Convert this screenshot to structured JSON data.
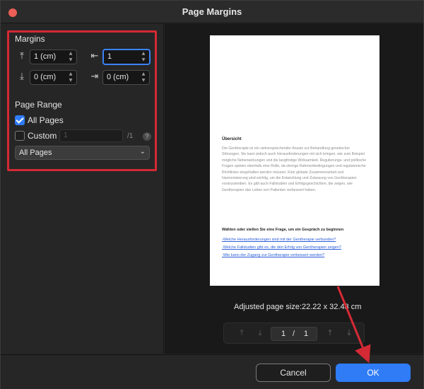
{
  "window": {
    "title": "Page Margins"
  },
  "margins": {
    "heading": "Margins",
    "top": {
      "value": "1 (cm)",
      "icon": "margin-top-icon"
    },
    "left": {
      "value": "1",
      "icon": "margin-left-icon"
    },
    "bottom": {
      "value": "0 (cm)",
      "icon": "margin-bottom-icon"
    },
    "right": {
      "value": "0 (cm)",
      "icon": "margin-right-icon"
    }
  },
  "page_range": {
    "heading": "Page Range",
    "all_pages_label": "All Pages",
    "all_pages_checked": true,
    "custom_label": "Custom",
    "custom_checked": false,
    "custom_placeholder": "1",
    "total": "/1",
    "help": "?",
    "select_value": "All Pages"
  },
  "document": {
    "heading": "Übersicht",
    "paragraph": "Die Gentherapie ist ein vielversprechender Ansatz zur Behandlung genetischer Störungen. Sie kann jedoch auch Herausforderungen mit sich bringen, wie zum Beispiel mögliche Nebenwirkungen und die langfristige Wirksamkeit. Regulierungs- und politische Fragen spielen ebenfalls eine Rolle, da strenge Rahmenbedingungen und regulatorische Richtlinien eingehalten werden müssen. Eine globale Zusammenarbeit und Harmonisierung sind wichtig, um die Entwicklung und Zulassung von Gentherapien voranzutreiben. Es gibt auch Fallstudien und Erfolgsgeschichten, die zeigen, wie Gentherapien das Leben von Patienten verbessert haben.",
    "question": "Wählen oder stellen Sie eine Frage, um ein Gespräch zu beginnen",
    "links": [
      "-Welche Herausforderungen sind mit der Gentherapie verbunden?",
      "-Welche Fallstudien gibt es, die den Erfolg von Gentherapien zeigen?",
      "-Wie kann der Zugang zur Gentherapie verbessert werden?"
    ]
  },
  "preview": {
    "page_size": "Adjusted page size:22.22 x 32.43 cm",
    "current_page": "1",
    "separator": "/",
    "total_pages": "1"
  },
  "footer": {
    "cancel_label": "Cancel",
    "ok_label": "OK"
  },
  "colors": {
    "accent": "#2f7cf6",
    "highlight": "#d42a35",
    "close": "#ec5f57"
  }
}
